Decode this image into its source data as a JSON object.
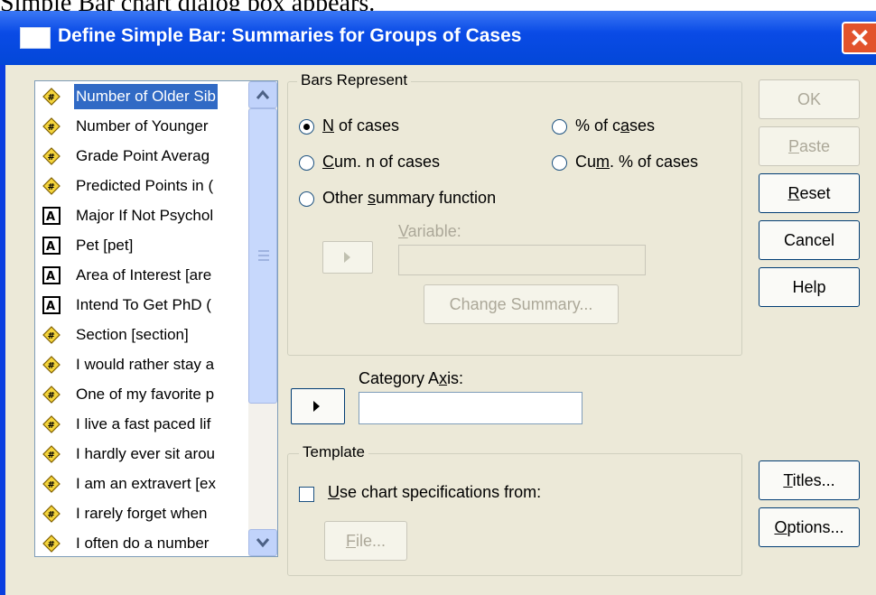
{
  "page_caption": "Simple Bar chart dialog box appears.",
  "dialog": {
    "title": "Define Simple Bar: Summaries for Groups of Cases",
    "close_glyph": "✕"
  },
  "variables": [
    {
      "label": "Number of Older Sib",
      "type": "scale",
      "selected": true
    },
    {
      "label": "Number of Younger",
      "type": "scale"
    },
    {
      "label": "Grade Point Averag",
      "type": "scale"
    },
    {
      "label": "Predicted Points in (",
      "type": "scale"
    },
    {
      "label": "Major If Not Psychol",
      "type": "string"
    },
    {
      "label": "Pet [pet]",
      "type": "string"
    },
    {
      "label": "Area of Interest [are",
      "type": "string"
    },
    {
      "label": "Intend To Get PhD (",
      "type": "string"
    },
    {
      "label": "Section [section]",
      "type": "scale"
    },
    {
      "label": "I would rather stay a",
      "type": "scale"
    },
    {
      "label": "One of my favorite p",
      "type": "scale"
    },
    {
      "label": "I live a fast paced lif",
      "type": "scale"
    },
    {
      "label": "I hardly ever sit arou",
      "type": "scale"
    },
    {
      "label": "I am an extravert [ex",
      "type": "scale"
    },
    {
      "label": "I rarely forget when",
      "type": "scale"
    },
    {
      "label": "I often do a number",
      "type": "scale"
    }
  ],
  "bars_represent": {
    "legend": "Bars Represent",
    "n_of_cases": {
      "pre": "",
      "mnemonic": "N",
      "post": " of cases",
      "checked": true
    },
    "pct_of_cases": {
      "pre": "% of c",
      "mnemonic": "a",
      "post": "ses"
    },
    "cum_n_of_cases": {
      "pre": "",
      "mnemonic": "C",
      "post": "um. n of cases"
    },
    "cum_pct_of_cases": {
      "pre": "Cu",
      "mnemonic": "m",
      "post": ". % of cases"
    },
    "other_summary": {
      "pre": "Other ",
      "mnemonic": "s",
      "post": "ummary function"
    },
    "variable_label": {
      "pre": "",
      "mnemonic": "V",
      "post": "ariable:"
    },
    "variable_value": "",
    "change_summary_button": "Change Summary..."
  },
  "category_axis": {
    "label": {
      "pre": "Category A",
      "mnemonic": "x",
      "post": "is:"
    },
    "value": ""
  },
  "template": {
    "legend": "Template",
    "use_chart_spec": {
      "pre": "",
      "mnemonic": "U",
      "post": "se chart specifications from:",
      "checked": false
    },
    "file_button": {
      "pre": "",
      "mnemonic": "F",
      "post": "ile..."
    }
  },
  "buttons": {
    "ok": "OK",
    "paste": {
      "pre": "",
      "mnemonic": "P",
      "post": "aste"
    },
    "reset": {
      "pre": "",
      "mnemonic": "R",
      "post": "eset"
    },
    "cancel": "Cancel",
    "help": "Help",
    "titles": {
      "pre": "",
      "mnemonic": "T",
      "post": "itles..."
    },
    "options": {
      "pre": "",
      "mnemonic": "O",
      "post": "ptions..."
    }
  },
  "colors": {
    "titlebar": "#0a4be6",
    "dialog_face": "#ece9d8",
    "selection": "#316ac5",
    "close_button": "#e2532c"
  }
}
